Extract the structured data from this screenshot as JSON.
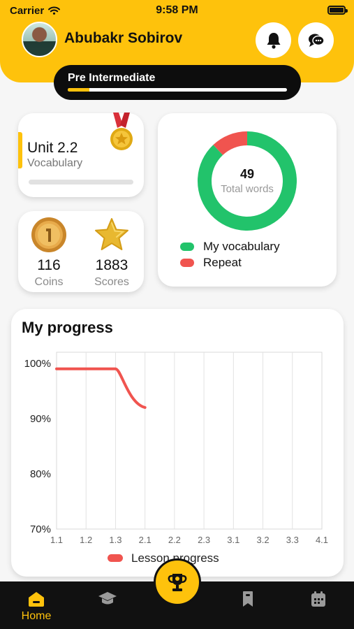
{
  "status_bar": {
    "carrier": "Carrier",
    "time": "9:58 PM"
  },
  "header": {
    "user_name": "Abubakr Sobirov",
    "level": {
      "label": "Pre Intermediate",
      "progress": 0.1
    }
  },
  "unit_card": {
    "title": "Unit 2.2",
    "subtitle": "Vocabulary",
    "progress": 0.0
  },
  "stats": {
    "coins": {
      "value": "116",
      "label": "Coins"
    },
    "scores": {
      "value": "1883",
      "label": "Scores"
    }
  },
  "words_card": {
    "total": "49",
    "total_label": "Total words",
    "legend": [
      {
        "label": "My vocabulary",
        "color": "#22c36b"
      },
      {
        "label": "Repeat",
        "color": "#f0544f"
      }
    ],
    "segments": [
      {
        "name": "My vocabulary",
        "fraction": 0.88,
        "color": "#22c36b"
      },
      {
        "name": "Repeat",
        "fraction": 0.12,
        "color": "#f0544f"
      }
    ]
  },
  "progress_card": {
    "title": "My progress",
    "chart_data": {
      "type": "line",
      "x_ticks": [
        "1.1",
        "1.2",
        "1.3",
        "2.1",
        "2.2",
        "2.3",
        "3.1",
        "3.2",
        "3.3",
        "4.1"
      ],
      "y_ticks": [
        "100%",
        "90%",
        "80%",
        "70%"
      ],
      "ylim": [
        70,
        102
      ],
      "grid": true,
      "legend_position": "bottom",
      "series": [
        {
          "name": "Lesson progress",
          "color": "#f0544f",
          "x": [
            "1.1",
            "1.2",
            "1.3",
            "2.1"
          ],
          "values": [
            99,
            99,
            99,
            92
          ]
        }
      ]
    }
  },
  "tabbar": {
    "home_label": "Home"
  },
  "colors": {
    "accent": "#fec20c",
    "dark": "#111111",
    "green": "#22c36b",
    "red": "#f0544f"
  }
}
